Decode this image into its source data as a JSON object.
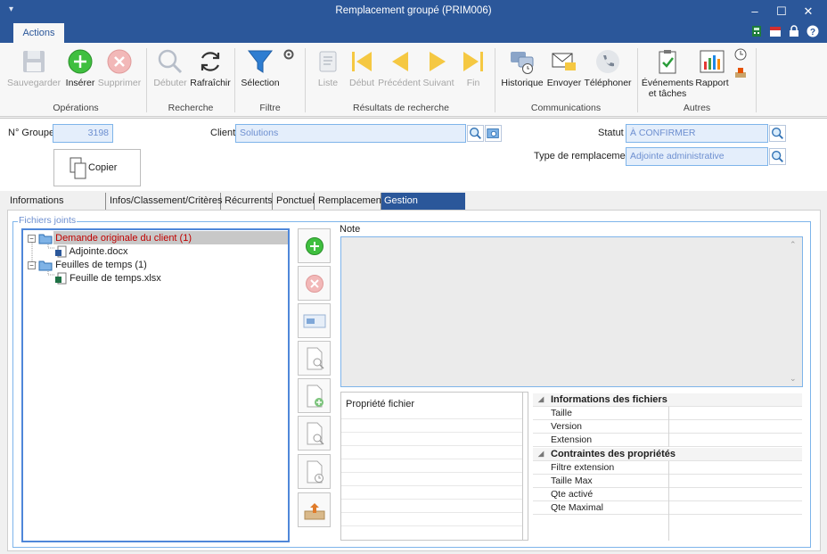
{
  "window": {
    "title": "Remplacement groupé (PRIM006)"
  },
  "ribbon_tab": "Actions",
  "ribbon": {
    "operations": {
      "label": "Opérations",
      "save": "Sauvegarder",
      "insert": "Insérer",
      "delete": "Supprimer"
    },
    "search": {
      "label": "Recherche",
      "start": "Débuter",
      "refresh": "Rafraîchir"
    },
    "filter": {
      "label": "Filtre",
      "selection": "Sélection"
    },
    "results": {
      "label": "Résultats de recherche",
      "list": "Liste",
      "first": "Début",
      "prev": "Précédent",
      "next": "Suivant",
      "last": "Fin"
    },
    "comms": {
      "label": "Communications",
      "history": "Historique",
      "send": "Envoyer",
      "phone": "Téléphoner"
    },
    "other": {
      "label": "Autres",
      "events": "Événements et tâches",
      "report": "Rapport"
    }
  },
  "header": {
    "group_no_label": "N° Groupe",
    "group_no": "3198",
    "client_label": "Client",
    "client": "Solutions",
    "status_label": "Statut",
    "status": "À CONFIRMER",
    "type_label": "Type de remplacement",
    "type": "Adjointe administrative",
    "copy_button": "Copier"
  },
  "tabs": [
    "Informations générales",
    "Infos/Classement/Critères",
    "Récurrents",
    "Ponctuel",
    "Remplacements",
    "Gestion documents"
  ],
  "files": {
    "title": "Fichiers joints",
    "tree": [
      {
        "label": "Demande originale du client (1)",
        "children": [
          "Adjointe.docx"
        ]
      },
      {
        "label": "Feuilles de temps (1)",
        "children": [
          "Feuille de temps.xlsx"
        ]
      }
    ]
  },
  "note_label": "Note",
  "property_header": "Propriété fichier",
  "grid": {
    "cat1": "Informations des fichiers",
    "cat1_rows": [
      "Taille",
      "Version",
      "Extension"
    ],
    "cat2": "Contraintes des propriétés",
    "cat2_rows": [
      "Filtre extension",
      "Taille Max",
      "Qte activé",
      "Qte Maximal"
    ]
  },
  "colors": {
    "accent": "#2b579a",
    "field_bg": "#e4eefb",
    "field_text": "#6d8fd0",
    "selected_node": "#c00000"
  }
}
